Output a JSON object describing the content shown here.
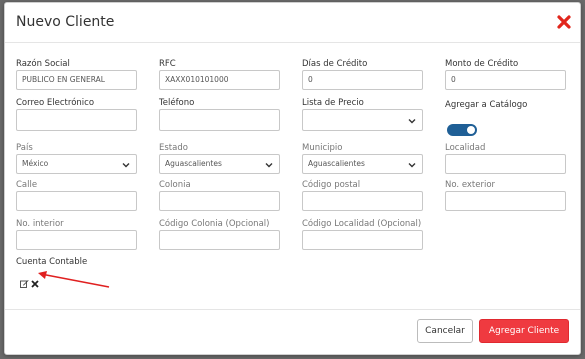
{
  "modal": {
    "title": "Nuevo Cliente",
    "close_icon": "close-icon",
    "accent_color": "#e1261c"
  },
  "fields": {
    "razon_social": {
      "label": "Razón Social",
      "value": "PUBLICO EN GENERAL"
    },
    "rfc": {
      "label": "RFC",
      "value": "XAXX010101000"
    },
    "dias_credito": {
      "label": "Días de Crédito",
      "value": "0"
    },
    "monto_credito": {
      "label": "Monto de Crédito",
      "value": "0"
    },
    "correo": {
      "label": "Correo Electrónico",
      "value": ""
    },
    "telefono": {
      "label": "Teléfono",
      "value": ""
    },
    "lista_precio": {
      "label": "Lista de Precio",
      "value": ""
    },
    "agregar_catalogo": {
      "label": "Agregar a Catálogo",
      "enabled": true
    },
    "pais": {
      "label": "País",
      "value": "México"
    },
    "estado": {
      "label": "Estado",
      "value": "Aguascalientes"
    },
    "municipio": {
      "label": "Municipio",
      "value": "Aguascalientes"
    },
    "localidad": {
      "label": "Localidad",
      "value": ""
    },
    "calle": {
      "label": "Calle",
      "value": ""
    },
    "colonia": {
      "label": "Colonia",
      "value": ""
    },
    "codigo_postal": {
      "label": "Código postal",
      "value": ""
    },
    "no_exterior": {
      "label": "No. exterior",
      "value": ""
    },
    "no_interior": {
      "label": "No. interior",
      "value": ""
    },
    "codigo_colonia": {
      "label": "Código Colonia (Opcional)",
      "value": ""
    },
    "codigo_localidad": {
      "label": "Código Localidad (Opcional)",
      "value": ""
    },
    "cuenta_contable": {
      "label": "Cuenta Contable",
      "edit_icon": "edit-icon",
      "remove_icon": "remove-icon"
    }
  },
  "footer": {
    "cancel_label": "Cancelar",
    "submit_label": "Agregar Cliente",
    "submit_color": "#ef3a40"
  },
  "annotation": {
    "arrow_color": "#e02020"
  }
}
